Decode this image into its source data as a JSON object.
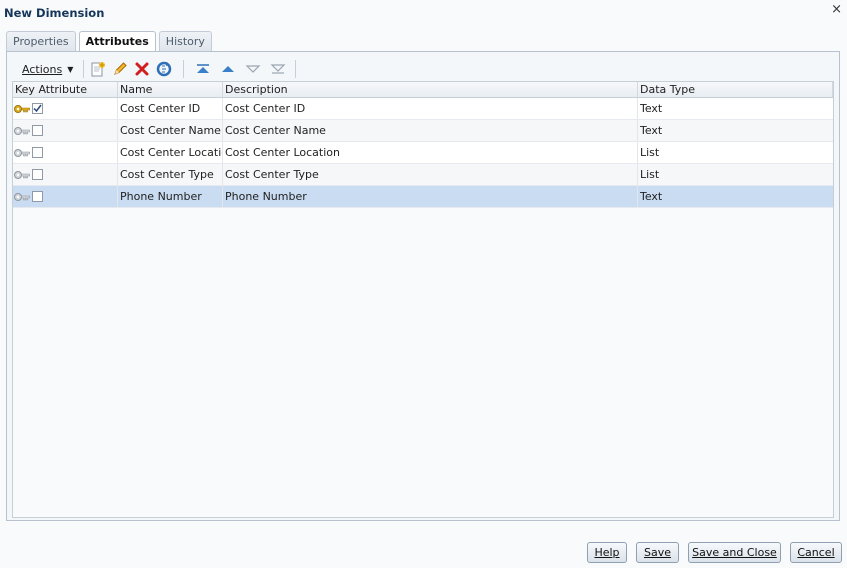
{
  "dialog": {
    "title": "New Dimension",
    "close_label": "×"
  },
  "tabs": [
    {
      "label": "Properties",
      "active": false
    },
    {
      "label": "Attributes",
      "active": true
    },
    {
      "label": "History",
      "active": false
    }
  ],
  "toolbar": {
    "actions_label": "Actions",
    "icons": [
      "new-attribute-icon",
      "edit-icon",
      "delete-icon",
      "refresh-icon",
      "move-top-icon",
      "move-up-icon",
      "move-down-icon",
      "move-bottom-icon"
    ]
  },
  "grid": {
    "columns": [
      "Key Attribute",
      "Name",
      "Description",
      "Data Type"
    ],
    "rows": [
      {
        "key": true,
        "name": "Cost Center ID",
        "description": "Cost Center ID",
        "data_type": "Text"
      },
      {
        "key": false,
        "name": "Cost Center Name",
        "description": "Cost Center Name",
        "data_type": "Text"
      },
      {
        "key": false,
        "name": "Cost Center Location",
        "description": "Cost Center Location",
        "data_type": "List"
      },
      {
        "key": false,
        "name": "Cost Center Type",
        "description": "Cost Center Type",
        "data_type": "List"
      },
      {
        "key": false,
        "name": "Phone Number",
        "description": "Phone Number",
        "data_type": "Text",
        "selected": true
      }
    ]
  },
  "footer": {
    "help_label": "Help",
    "save_label": "Save",
    "save_close_label": "Save and Close",
    "cancel_label": "Cancel"
  },
  "colors": {
    "title": "#15365a",
    "selected_row": "#c9dcf2",
    "key_active": "#e0b020",
    "key_inactive": "#a0a6ad",
    "delete_red": "#d01f1f",
    "nav_arrow_blue": "#2e6fb8"
  }
}
